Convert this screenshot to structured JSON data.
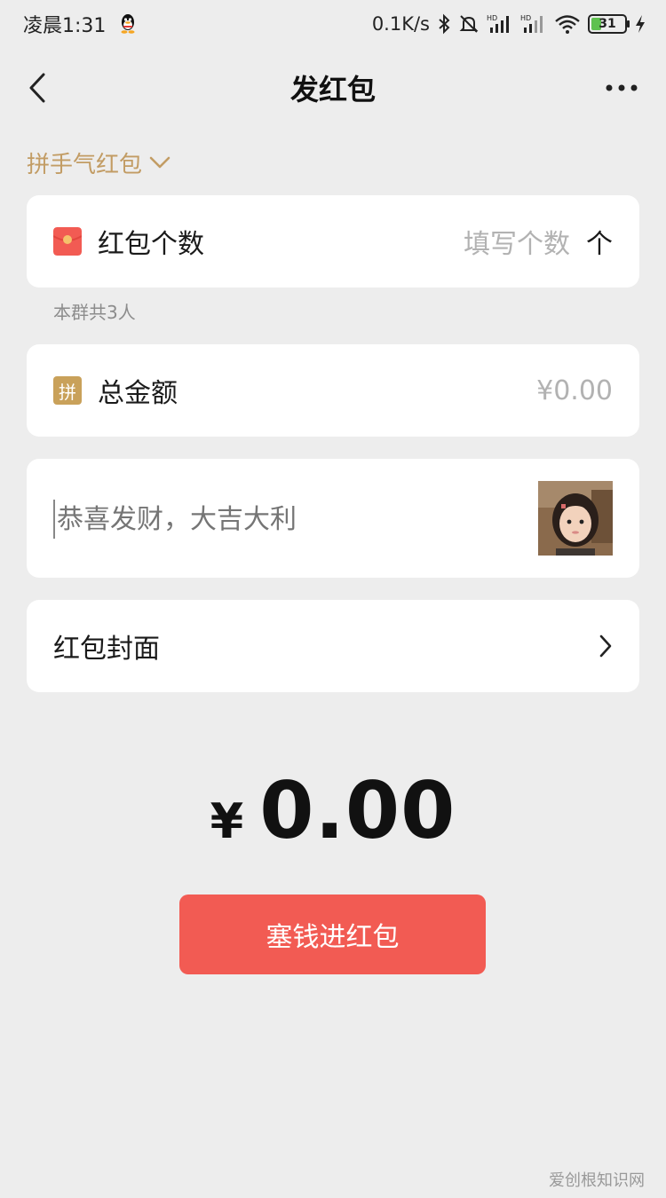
{
  "status_bar": {
    "time": "凌晨1:31",
    "net_speed": "0.1K/s",
    "battery_level": "31",
    "battery_fraction": 0.31,
    "icons": [
      "qq-icon",
      "bluetooth-icon",
      "bell-off-icon",
      "signal-hd-icon",
      "signal-hd-icon",
      "wifi-icon",
      "battery-icon",
      "charging-icon"
    ]
  },
  "nav": {
    "title": "发红包",
    "back_icon": "chevron-left-icon",
    "more_icon": "more-horizontal-icon"
  },
  "packet_type": {
    "label": "拼手气红包",
    "icon": "chevron-down-icon"
  },
  "count_row": {
    "label": "红包个数",
    "placeholder": "填写个数",
    "unit": "个",
    "icon": "red-packet-icon",
    "icon_color": "#f25b53"
  },
  "count_hint": "本群共3人",
  "amount_row": {
    "label": "总金额",
    "placeholder": "¥0.00",
    "icon": "pin-icon",
    "icon_char": "拼",
    "icon_color": "#c9a15a"
  },
  "greeting": {
    "placeholder": "恭喜发财，大吉大利",
    "emoji_icon": "girl-avatar-sticker"
  },
  "cover_row": {
    "label": "红包封面",
    "icon": "chevron-right-icon"
  },
  "total": {
    "currency": "¥",
    "value": "0.00"
  },
  "submit": {
    "label": "塞钱进红包",
    "color": "#f25b53"
  },
  "watermark": "爱创根知识网"
}
